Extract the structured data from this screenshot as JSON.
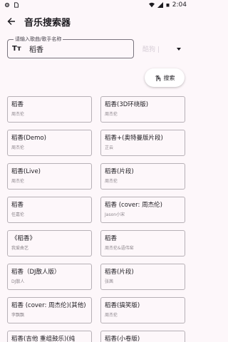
{
  "status_bar": {
    "time": "2:04"
  },
  "app_bar": {
    "title": "音乐搜索器",
    "back_icon": "arrow-back-icon"
  },
  "search": {
    "label": "请输入歌曲/歌手名称",
    "value": "稻香",
    "source": "酷狗 |"
  },
  "search_button": {
    "label": "搜索",
    "icon": "touch-icon"
  },
  "results": [
    {
      "title": "稻香",
      "artist": "周杰伦"
    },
    {
      "title": "稻香(3D环绕版)",
      "artist": "周杰伦"
    },
    {
      "title": "稻香(Demo)",
      "artist": "周杰伦"
    },
    {
      "title": "稻香+(奥特曼版片段)",
      "artist": "芷云"
    },
    {
      "title": "稻香(Live)",
      "artist": "周杰伦"
    },
    {
      "title": "稻香(片段)",
      "artist": "周杰伦"
    },
    {
      "title": "稻香",
      "artist": "任嘉伦"
    },
    {
      "title": "稻香 (cover: 周杰伦)",
      "artist": "Jason小宋"
    },
    {
      "title": "《稻香》",
      "artist": "我爱曲艺"
    },
    {
      "title": "稻香",
      "artist": "周杰伦&语伟窑"
    },
    {
      "title": "稻香（DJ散人版）",
      "artist": "DJ散人"
    },
    {
      "title": "稻香(片段)",
      "artist": "张茜"
    },
    {
      "title": "稻香 (cover: 周杰伦)(其他)",
      "artist": "李飘飘"
    },
    {
      "title": "稻香(搞笑版)",
      "artist": "周杰伦"
    },
    {
      "title": "稻香(吉他 重组鼓乐)(纯",
      "artist": ""
    },
    {
      "title": "稻香(小卷版)",
      "artist": ""
    }
  ]
}
